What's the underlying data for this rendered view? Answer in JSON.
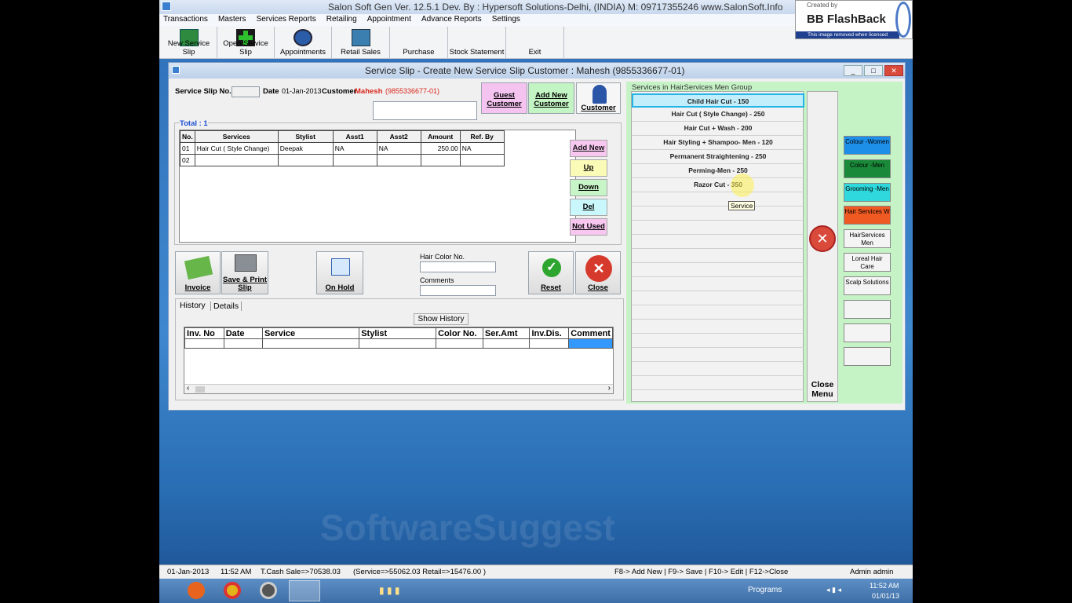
{
  "app_title": "Salon Soft Gen Ver. 12.5.1 Dev. By : Hypersoft Solutions-Delhi, (INDIA) M: 09717355246  www.SalonSoft.Info",
  "menu": [
    "Transactions",
    "Masters",
    "Services Reports",
    "Retailing",
    "Appointment",
    "Advance Reports",
    "Settings"
  ],
  "toolbar": [
    "New Service Slip",
    "Open Service Slip",
    "Appointments",
    "Retail Sales",
    "Purchase",
    "Stock Statement",
    "Exit"
  ],
  "flashback": {
    "created_by": "Created by",
    "brand": "BB FlashBack",
    "notice": "This image removed when licensed"
  },
  "window": {
    "title": "Service Slip - Create New Service Slip  Customer : Mahesh  (9855336677-01)",
    "controls": [
      "_",
      "□",
      "✕"
    ],
    "slip_no_label": "Service Slip No.",
    "date_label": "Date",
    "date_value": "01-Jan-2013",
    "customer_label": "Customer",
    "customer_name": "Mahesh",
    "customer_phone": "(9855336677-01)",
    "guest_btn": "Guest Customer",
    "addnew_btn": "Add New Customer",
    "customer_btn": "Customer",
    "total_label": "Total : 1",
    "columns": [
      "No.",
      "Services",
      "Stylist",
      "Asst1",
      "Asst2",
      "Amount",
      "Ref. By"
    ],
    "rows": [
      [
        "01",
        "Hair Cut ( Style Change)",
        "Deepak",
        "NA",
        "NA",
        "250.00",
        "NA"
      ],
      [
        "02",
        "",
        "",
        "",
        "",
        "",
        ""
      ]
    ],
    "side_buttons": [
      "Add New",
      "Up",
      "Down",
      "Del",
      "Not Used"
    ],
    "actions": {
      "invoice": "Invoice",
      "save_print": "Save & Print Slip",
      "on_hold": "On Hold",
      "reset": "Reset",
      "close": "Close"
    },
    "hair_color_label": "Hair Color No.",
    "comments_label": "Comments",
    "tabs": [
      "History",
      "Details"
    ],
    "show_history": "Show History",
    "history_columns": [
      "Inv. No",
      "Date",
      "Service",
      "Stylist",
      "Color No.",
      "Ser.Amt",
      "Inv.Dis.",
      "Comment"
    ]
  },
  "services_panel": {
    "title": "Services in HairServices Men Group",
    "items": [
      "Child Hair Cut  -  150",
      "Hair Cut ( Style Change)  -  250",
      "Hair Cut + Wash  -  200",
      "Hair Styling + Shampoo- Men  -  120",
      "Permanent Straightening  -  250",
      "Perming-Men  -  250",
      "Razor Cut  -  350"
    ],
    "tooltip": "Service",
    "close_menu": "Close Menu",
    "groups": [
      {
        "label": "Colour -Women",
        "color": "#1e8fe8"
      },
      {
        "label": "Colour -Men",
        "color": "#1a8a3a"
      },
      {
        "label": "Grooming -Men",
        "color": "#2ed8dc"
      },
      {
        "label": "Hair Services W",
        "color": "#ee5a22"
      },
      {
        "label": "HairServices Men",
        "color": "#f4f4f4"
      },
      {
        "label": "Loreal Hair Care",
        "color": "#f4f4f4"
      },
      {
        "label": "Scalp Solutions",
        "color": "#f4f4f4"
      },
      {
        "label": "",
        "color": "#f4f4f4"
      },
      {
        "label": "",
        "color": "#f4f4f4"
      },
      {
        "label": "",
        "color": "#f4f4f4"
      }
    ]
  },
  "statusbar": {
    "date": "01-Jan-2013",
    "time": "11:52 AM",
    "cash": "T.Cash Sale=>70538.03",
    "breakdown": "(Service=>55062.03  Retail=>15476.00  )",
    "shortcuts": "F8-> Add New | F9-> Save | F10-> Edit | F12->Close",
    "user": "Admin admin"
  },
  "taskbar": {
    "programs": "Programs",
    "clock_time": "11:52 AM",
    "clock_date": "01/01/13"
  },
  "watermark": "SoftwareSuggest"
}
